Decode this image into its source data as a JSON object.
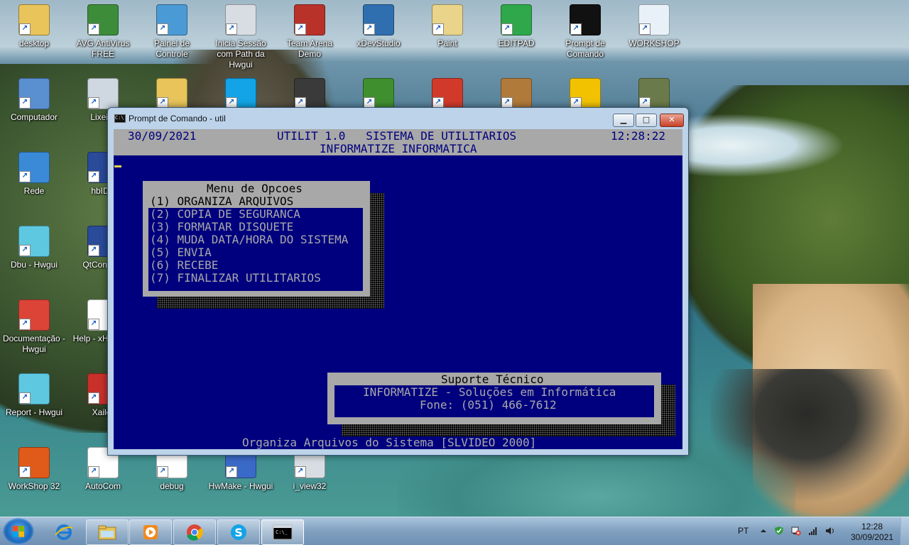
{
  "desktop": {
    "icons": [
      {
        "label": "desktop",
        "icon": "folder-user-icon",
        "color": "#e8c45a"
      },
      {
        "label": "AVG AntiVirus FREE",
        "icon": "avg-antivirus-icon",
        "color": "#3d8c3a"
      },
      {
        "label": "Painel de Controle",
        "icon": "control-panel-icon",
        "color": "#4a9ad6"
      },
      {
        "label": "Inicia Sessão com Path da Hwgui",
        "icon": "gear-shortcut-icon",
        "color": "#d8dde3"
      },
      {
        "label": "Team Arena Demo",
        "icon": "team-arena-icon",
        "color": "#b8322a"
      },
      {
        "label": "xDevStudio",
        "icon": "xdevstudio-icon",
        "color": "#2f6fb0"
      },
      {
        "label": "Paint",
        "icon": "paint-palette-icon",
        "color": "#e9d48a"
      },
      {
        "label": "EDITPAD",
        "icon": "editpad-notebook-icon",
        "color": "#2ea84a"
      },
      {
        "label": "Prompt de Comando",
        "icon": "command-prompt-icon",
        "color": "#111111"
      },
      {
        "label": "WORKSHOP",
        "icon": "workshop-icon",
        "color": "#e8f1f8"
      },
      {
        "label": "Computador",
        "icon": "computer-icon",
        "color": "#5a8fd0"
      },
      {
        "label": "Lixeira",
        "icon": "recycle-bin-icon",
        "color": "#cfd8e0"
      },
      {
        "label": "",
        "icon": "folder-gear-icon",
        "color": "#e8c45a"
      },
      {
        "label": "",
        "icon": "skype-icon",
        "color": "#12a4e6"
      },
      {
        "label": "",
        "icon": "phone-icon",
        "color": "#3a3a3a"
      },
      {
        "label": "",
        "icon": "tree-icon",
        "color": "#3f8f2e"
      },
      {
        "label": "",
        "icon": "app-red-icon",
        "color": "#d13a2a"
      },
      {
        "label": "",
        "icon": "donkey-icon",
        "color": "#b07a3a"
      },
      {
        "label": "",
        "icon": "shield-warning-icon",
        "color": "#f2c200"
      },
      {
        "label": "",
        "icon": "soldier-icon",
        "color": "#6b7a4a"
      },
      {
        "label": "Rede",
        "icon": "network-globe-icon",
        "color": "#3a8ad8"
      },
      {
        "label": "hbIDE",
        "icon": "harbour-sail-icon",
        "color": "#2a4a9a"
      },
      {
        "label": "Dbu - Hwgui",
        "icon": "dbu-ship-icon",
        "color": "#5ec8e0"
      },
      {
        "label": "QtContribs",
        "icon": "harbour-sail-icon",
        "color": "#2a4a9a"
      },
      {
        "label": "Documentação - Hwgui",
        "icon": "chrome-icon",
        "color": "#db4437"
      },
      {
        "label": "Help - xHarbour",
        "icon": "help-document-icon",
        "color": "#ffffff"
      },
      {
        "label": "Report - Hwgui",
        "icon": "report-ship-icon",
        "color": "#5ec8e0"
      },
      {
        "label": "Xailer",
        "icon": "xailer-sail-icon",
        "color": "#c8302a"
      },
      {
        "label": "WorkShop 32",
        "icon": "workshop32-icon",
        "color": "#e05a1a"
      },
      {
        "label": "AutoCom",
        "icon": "blank-document-icon",
        "color": "#ffffff"
      },
      {
        "label": "debug",
        "icon": "text-document-icon",
        "color": "#ffffff"
      },
      {
        "label": "HwMake - Hwgui",
        "icon": "hwmake-icon",
        "color": "#3a6ac8"
      },
      {
        "label": "i_view32",
        "icon": "gear-document-icon",
        "color": "#d8dde3"
      }
    ]
  },
  "window": {
    "title": "Prompt de Comando - util",
    "controls": {
      "minimize": "▁",
      "maximize": "□",
      "close": "✕"
    }
  },
  "console": {
    "header": {
      "date": "30/09/2021",
      "app_title": "UTILIT 1.0   SISTEMA DE UTILITARIOS",
      "time": "12:28:22",
      "company": "INFORMATIZE INFORMATICA"
    },
    "menu": {
      "title": "Menu de Opcoes",
      "items": [
        {
          "label": "(1) ORGANIZA ARQUIVOS",
          "selected": true
        },
        {
          "label": "(2) COPIA DE SEGURANCA",
          "selected": false
        },
        {
          "label": "(3) FORMATAR DISQUETE",
          "selected": false
        },
        {
          "label": "(4) MUDA DATA/HORA DO SISTEMA",
          "selected": false
        },
        {
          "label": "(5) ENVIA",
          "selected": false
        },
        {
          "label": "(6) RECEBE",
          "selected": false
        },
        {
          "label": "(7) FINALIZAR UTILITARIOS",
          "selected": false
        }
      ]
    },
    "support": {
      "title": "Suporte Técnico",
      "line1": "INFORMATIZE - Soluções em Informática",
      "line2": "Fone: (051) 466-7612"
    },
    "status": "Organiza Arquivos do Sistema [SLVIDEO 2000]",
    "colors": {
      "background": "#00007f",
      "text": "#a8a8a8",
      "panel": "#a8a8a8",
      "cursor": "#e6d24a"
    }
  },
  "taskbar": {
    "start": "start-button",
    "pinned": [
      {
        "icon": "internet-explorer-icon",
        "active": false
      },
      {
        "icon": "windows-explorer-icon",
        "active": false
      },
      {
        "icon": "media-player-icon",
        "active": false
      },
      {
        "icon": "chrome-icon",
        "active": false
      },
      {
        "icon": "skype-icon",
        "active": false
      },
      {
        "icon": "command-prompt-icon",
        "active": true
      }
    ],
    "tray": {
      "language": "PT",
      "icons": [
        "show-hidden-icons-arrow",
        "security-shield-icon",
        "network-disconnected-icon",
        "signal-bars-icon",
        "volume-icon"
      ],
      "time": "12:28",
      "date": "30/09/2021"
    }
  }
}
